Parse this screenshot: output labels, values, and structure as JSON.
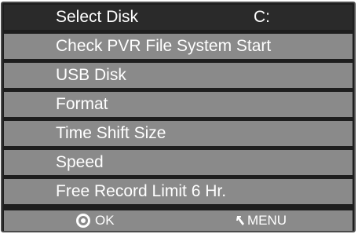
{
  "menu": {
    "items": [
      {
        "label": "Select Disk",
        "value": "C:",
        "selected": true
      },
      {
        "label": "Check PVR File System Start",
        "value": ""
      },
      {
        "label": "USB Disk",
        "value": ""
      },
      {
        "label": "Format",
        "value": ""
      },
      {
        "label": "Time Shift Size",
        "value": ""
      },
      {
        "label": "Speed",
        "value": ""
      },
      {
        "label": "Free Record Limit 6 Hr.",
        "value": ""
      }
    ]
  },
  "footer": {
    "ok_label": "OK",
    "ok_icon": "ok-button-icon",
    "menu_label": "MENU",
    "menu_icon": "menu-return-icon"
  },
  "colors": {
    "frame": "#1e1e1e",
    "row": "#8a8a8a",
    "selected_row": "#2a2a2a",
    "text": "#ffffff"
  }
}
